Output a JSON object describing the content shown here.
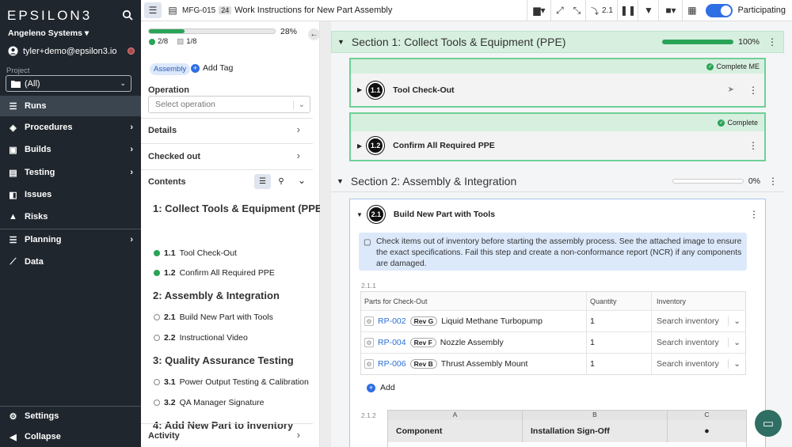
{
  "sidebar": {
    "logo": "EPSILON3",
    "org": "Angeleno Systems",
    "user": "tyler+demo@epsilon3.io",
    "project_label": "Project",
    "project_value": "(All)",
    "items": [
      {
        "label": "Runs",
        "icon": "list-icon",
        "active": true,
        "arrow": false
      },
      {
        "label": "Procedures",
        "icon": "stack-icon",
        "arrow": true
      },
      {
        "label": "Builds",
        "icon": "cubes-icon",
        "arrow": true
      },
      {
        "label": "Testing",
        "icon": "clipboard-icon",
        "arrow": true
      },
      {
        "label": "Issues",
        "icon": "issue-icon",
        "arrow": false
      },
      {
        "label": "Risks",
        "icon": "warning-icon",
        "arrow": false
      },
      {
        "label": "Planning",
        "icon": "planning-icon",
        "arrow": true
      },
      {
        "label": "Data",
        "icon": "chart-icon",
        "arrow": false
      }
    ],
    "settings": "Settings",
    "collapse": "Collapse"
  },
  "topbar": {
    "run_id": "MFG-015",
    "run_count": "24",
    "title": "Work Instructions for New Part Assembly",
    "step_jump": "2.1",
    "participating": "Participating"
  },
  "panel": {
    "progress_pct": "28%",
    "progress_value": 0.28,
    "completed": "2/8",
    "skipped": "1/8",
    "tag": "Assembly",
    "add_tag": "Add Tag",
    "operation_label": "Operation",
    "operation_placeholder": "Select operation",
    "details": "Details",
    "checked_out": "Checked out",
    "contents": "Contents",
    "activity": "Activity",
    "toc": [
      {
        "type": "h",
        "label": "1: Collect Tools & Equipment (PPE"
      },
      {
        "type": "i",
        "num": "1.1",
        "label": "Tool Check-Out",
        "done": true
      },
      {
        "type": "i",
        "num": "1.2",
        "label": "Confirm All Required PPE",
        "done": true
      },
      {
        "type": "h",
        "label": "2: Assembly & Integration"
      },
      {
        "type": "i",
        "num": "2.1",
        "label": "Build New Part with Tools",
        "done": false
      },
      {
        "type": "i",
        "num": "2.2",
        "label": "Instructional Video",
        "done": false
      },
      {
        "type": "h",
        "label": "3: Quality Assurance Testing"
      },
      {
        "type": "i",
        "num": "3.1",
        "label": "Power Output Testing & Calibration",
        "done": false
      },
      {
        "type": "i",
        "num": "3.2",
        "label": "QA Manager Signature",
        "done": false
      },
      {
        "type": "h",
        "label": "4: Add New Part to Inventory"
      }
    ]
  },
  "main": {
    "section1": {
      "title": "Section 1: Collect Tools & Equipment (PPE)",
      "pct": "100%",
      "value": 1.0
    },
    "step11": {
      "num": "1.1",
      "title": "Tool Check-Out",
      "status": "Complete ME"
    },
    "step12": {
      "num": "1.2",
      "title": "Confirm All Required PPE",
      "status": "Complete"
    },
    "section2": {
      "title": "Section 2: Assembly & Integration",
      "pct": "0%",
      "value": 0
    },
    "step21": {
      "num": "2.1",
      "title": "Build New Part with Tools",
      "note": "Check items out of inventory before starting the assembly process. See the attached image to ensure the exact specifications. Fail this step and create a non-conformance report (NCR) if any components are damaged.",
      "block1": "2.1.1",
      "block2": "2.1.2",
      "parts_headers": [
        "Parts for Check-Out",
        "Quantity",
        "Inventory"
      ],
      "parts": [
        {
          "id": "RP-002",
          "rev": "Rev G",
          "name": "Liquid Methane Turbopump",
          "qty": "1",
          "inv": "Search inventory"
        },
        {
          "id": "RP-004",
          "rev": "Rev F",
          "name": "Nozzle Assembly",
          "qty": "1",
          "inv": "Search inventory"
        },
        {
          "id": "RP-006",
          "rev": "Rev B",
          "name": "Thrust Assembly Mount",
          "qty": "1",
          "inv": "Search inventory"
        }
      ],
      "add": "Add",
      "grid_cols": [
        "A",
        "B",
        "C"
      ],
      "grid_heads": [
        "Component",
        "Installation Sign-Off"
      ]
    }
  },
  "colors": {
    "accent": "#2f6fe4",
    "green": "#2aa457",
    "sidebar": "#20262d"
  }
}
